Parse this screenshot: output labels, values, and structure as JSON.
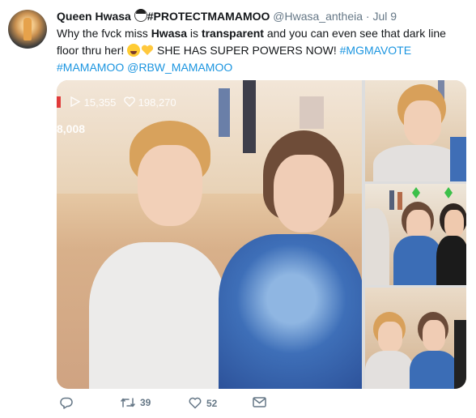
{
  "tweet": {
    "author_name": "Queen Hwasa",
    "author_name_tag": "#PROTECTMAMAMOO",
    "handle": "@Hwasa_antheia",
    "separator": "·",
    "date": "Jul 9",
    "text": {
      "part1": "Why the fvck miss ",
      "bold1": "Hwasa",
      "part2": " is ",
      "bold2": "transparent",
      "part3": " and you can even see that dark line floor thru her! ",
      "part4": " SHE HAS SUPER POWERS NOW! ",
      "hashtag1": "#MGMAVOTE",
      "hashtag2": "#MAMAMOO",
      "mention": "@RBW_MAMAMOO"
    }
  },
  "media": {
    "overlay_plays": "15,355",
    "overlay_likes": "198,270",
    "overlay_count": "8,008"
  },
  "actions": {
    "reply_icon": "reply-icon",
    "retweet_count": "39",
    "like_count": "52",
    "message_icon": "envelope-icon"
  },
  "colors": {
    "link": "#1b95e0",
    "muted": "#657786",
    "text": "#14171a"
  }
}
